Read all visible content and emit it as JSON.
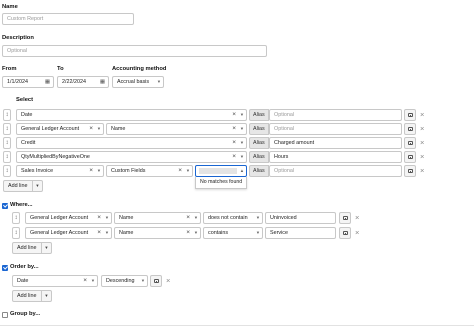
{
  "name": {
    "label": "Name",
    "placeholder": "Custom Report"
  },
  "description": {
    "label": "Description",
    "placeholder": "Optional"
  },
  "date_range": {
    "from_label": "From",
    "from_value": "1/1/2024",
    "to_label": "To",
    "to_value": "2/22/2024"
  },
  "accounting": {
    "label": "Accounting method",
    "value": "Accrual basis"
  },
  "select": {
    "label": "Select",
    "alias_label": "Alias",
    "alias_placeholder": "Optional",
    "rows": [
      {
        "field": "Date",
        "alias": ""
      },
      {
        "field": "General Ledger Account",
        "subfield": "Name",
        "alias": ""
      },
      {
        "field": "Credit",
        "alias": "Charged amount"
      },
      {
        "field": "QtyMultipliedByNegativeOne",
        "alias": "Hours"
      },
      {
        "field": "Sales Invoice",
        "subfield": "Custom Fields",
        "subfield2": "",
        "alias": ""
      }
    ],
    "dropdown_empty": "No matches found",
    "add_line": "Add line"
  },
  "where": {
    "label": "Where...",
    "checked": true,
    "rows": [
      {
        "field": "General Ledger Account",
        "subfield": "Name",
        "operator": "does not contain",
        "value": "Uninvoiced"
      },
      {
        "field": "General Ledger Account",
        "subfield": "Name",
        "operator": "contains",
        "value": "Service"
      }
    ],
    "add_line": "Add line"
  },
  "order_by": {
    "label": "Order by...",
    "checked": true,
    "rows": [
      {
        "field": "Date",
        "direction": "Descending"
      }
    ],
    "add_line": "Add line"
  },
  "group_by": {
    "label": "Group by...",
    "checked": false
  },
  "colors": {
    "accent": "#1a66d2",
    "border": "#c8c8c8",
    "alias_bg": "#e6e6e6"
  }
}
